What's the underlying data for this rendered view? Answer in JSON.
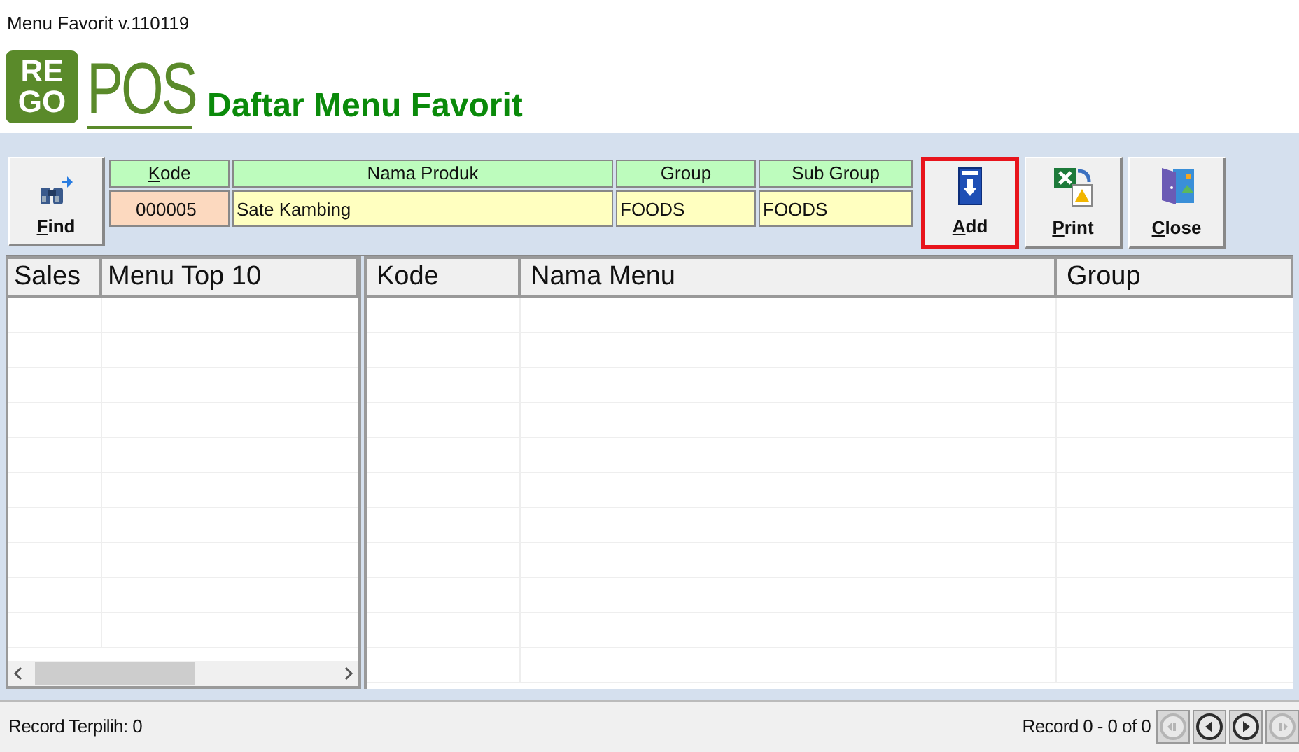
{
  "window": {
    "title": "Menu Favorit v.110119"
  },
  "logo": {
    "mark_lines": [
      "RE",
      "GO"
    ],
    "wordmark": "POS"
  },
  "heading": "Daftar Menu Favorit",
  "toolbar": {
    "find": "Find",
    "fields": [
      {
        "label": "Kode",
        "value": "000005",
        "kind": "key"
      },
      {
        "label": "Nama Produk",
        "value": "Sate Kambing",
        "kind": "text"
      },
      {
        "label": "Group",
        "value": "FOODS",
        "kind": "text"
      },
      {
        "label": "Sub Group",
        "value": "FOODS",
        "kind": "text"
      }
    ],
    "buttons": [
      {
        "label": "Add",
        "kind": "add",
        "highlighted": true
      },
      {
        "label": "Print",
        "kind": "print",
        "highlighted": false
      },
      {
        "label": "Close",
        "kind": "close",
        "highlighted": false
      }
    ]
  },
  "top_table": {
    "columns": [
      "Sales",
      "Menu Top 10"
    ]
  },
  "menu_table": {
    "columns": [
      "Kode",
      "Nama Menu",
      "Group"
    ]
  },
  "status_bar": {
    "selected": "Record Terpilih: 0",
    "record": "Record 0 - 0 of 0",
    "nav": [
      {
        "kind": "first",
        "disabled": true
      },
      {
        "kind": "prev",
        "disabled": false
      },
      {
        "kind": "next",
        "disabled": false
      },
      {
        "kind": "last",
        "disabled": true
      }
    ]
  }
}
